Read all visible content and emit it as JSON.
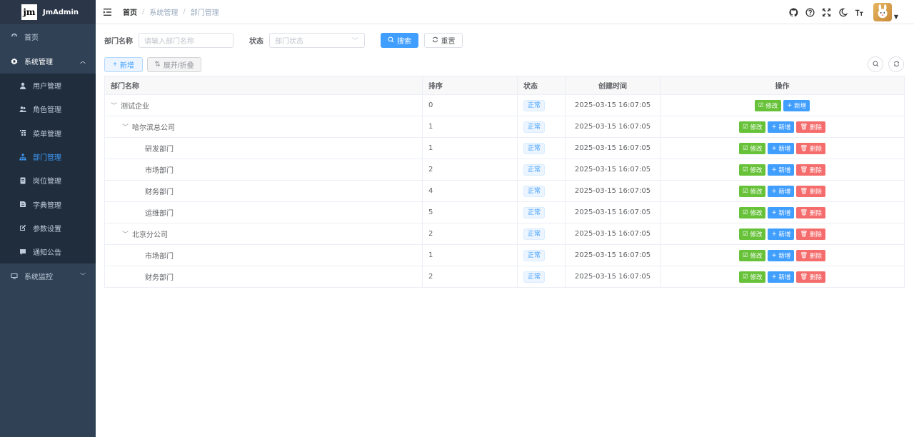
{
  "app": {
    "logo_text": "JmAdmin",
    "logo_mark": "jm"
  },
  "sidebar": {
    "home": "首页",
    "system": "系统管理",
    "items": [
      {
        "label": "用户管理",
        "icon": "user-icon"
      },
      {
        "label": "角色管理",
        "icon": "peoples-icon"
      },
      {
        "label": "菜单管理",
        "icon": "tree-table-icon"
      },
      {
        "label": "部门管理",
        "icon": "tree-icon"
      },
      {
        "label": "岗位管理",
        "icon": "post-icon"
      },
      {
        "label": "字典管理",
        "icon": "dict-icon"
      },
      {
        "label": "参数设置",
        "icon": "edit-icon"
      },
      {
        "label": "通知公告",
        "icon": "message-icon"
      }
    ],
    "monitor": "系统监控"
  },
  "breadcrumb": {
    "home": "首页",
    "level1": "系统管理",
    "level2": "部门管理"
  },
  "search": {
    "dept_label": "部门名称",
    "dept_placeholder": "请输入部门名称",
    "status_label": "状态",
    "status_placeholder": "部门状态",
    "search_btn": "搜索",
    "reset_btn": "重置"
  },
  "toolbar": {
    "add_btn": "新增",
    "expand_btn": "展开/折叠"
  },
  "table": {
    "headers": [
      "部门名称",
      "排序",
      "状态",
      "创建时间",
      "操作"
    ],
    "rows": [
      {
        "name": "测试企业",
        "sort": "0",
        "status": "正常",
        "time": "2025-03-15 16:07:05"
      },
      {
        "name": "哈尔滨总公司",
        "sort": "1",
        "status": "正常",
        "time": "2025-03-15 16:07:05"
      },
      {
        "name": "研发部门",
        "sort": "1",
        "status": "正常",
        "time": "2025-03-15 16:07:05"
      },
      {
        "name": "市场部门",
        "sort": "2",
        "status": "正常",
        "time": "2025-03-15 16:07:05"
      },
      {
        "name": "财务部门",
        "sort": "4",
        "status": "正常",
        "time": "2025-03-15 16:07:05"
      },
      {
        "name": "运维部门",
        "sort": "5",
        "status": "正常",
        "time": "2025-03-15 16:07:05"
      },
      {
        "name": "北京分公司",
        "sort": "2",
        "status": "正常",
        "time": "2025-03-15 16:07:05"
      },
      {
        "name": "市场部门",
        "sort": "1",
        "status": "正常",
        "time": "2025-03-15 16:07:05"
      },
      {
        "name": "财务部门",
        "sort": "2",
        "status": "正常",
        "time": "2025-03-15 16:07:05"
      }
    ],
    "actions": {
      "edit": "修改",
      "add": "新增",
      "delete": "删除"
    }
  },
  "colors": {
    "sidebar_bg": "#304156",
    "primary": "#409eff",
    "success": "#67c23a",
    "danger": "#f56c6c"
  }
}
